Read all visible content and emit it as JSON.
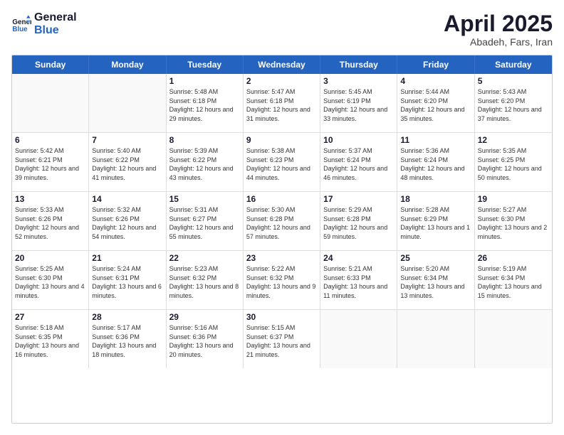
{
  "logo": {
    "line1": "General",
    "line2": "Blue"
  },
  "title": "April 2025",
  "subtitle": "Abadeh, Fars, Iran",
  "days": [
    "Sunday",
    "Monday",
    "Tuesday",
    "Wednesday",
    "Thursday",
    "Friday",
    "Saturday"
  ],
  "weeks": [
    [
      {
        "day": "",
        "empty": true
      },
      {
        "day": "",
        "empty": true
      },
      {
        "day": "1",
        "sunrise": "5:48 AM",
        "sunset": "6:18 PM",
        "daylight": "12 hours and 29 minutes."
      },
      {
        "day": "2",
        "sunrise": "5:47 AM",
        "sunset": "6:18 PM",
        "daylight": "12 hours and 31 minutes."
      },
      {
        "day": "3",
        "sunrise": "5:45 AM",
        "sunset": "6:19 PM",
        "daylight": "12 hours and 33 minutes."
      },
      {
        "day": "4",
        "sunrise": "5:44 AM",
        "sunset": "6:20 PM",
        "daylight": "12 hours and 35 minutes."
      },
      {
        "day": "5",
        "sunrise": "5:43 AM",
        "sunset": "6:20 PM",
        "daylight": "12 hours and 37 minutes."
      }
    ],
    [
      {
        "day": "6",
        "sunrise": "5:42 AM",
        "sunset": "6:21 PM",
        "daylight": "12 hours and 39 minutes."
      },
      {
        "day": "7",
        "sunrise": "5:40 AM",
        "sunset": "6:22 PM",
        "daylight": "12 hours and 41 minutes."
      },
      {
        "day": "8",
        "sunrise": "5:39 AM",
        "sunset": "6:22 PM",
        "daylight": "12 hours and 43 minutes."
      },
      {
        "day": "9",
        "sunrise": "5:38 AM",
        "sunset": "6:23 PM",
        "daylight": "12 hours and 44 minutes."
      },
      {
        "day": "10",
        "sunrise": "5:37 AM",
        "sunset": "6:24 PM",
        "daylight": "12 hours and 46 minutes."
      },
      {
        "day": "11",
        "sunrise": "5:36 AM",
        "sunset": "6:24 PM",
        "daylight": "12 hours and 48 minutes."
      },
      {
        "day": "12",
        "sunrise": "5:35 AM",
        "sunset": "6:25 PM",
        "daylight": "12 hours and 50 minutes."
      }
    ],
    [
      {
        "day": "13",
        "sunrise": "5:33 AM",
        "sunset": "6:26 PM",
        "daylight": "12 hours and 52 minutes."
      },
      {
        "day": "14",
        "sunrise": "5:32 AM",
        "sunset": "6:26 PM",
        "daylight": "12 hours and 54 minutes."
      },
      {
        "day": "15",
        "sunrise": "5:31 AM",
        "sunset": "6:27 PM",
        "daylight": "12 hours and 55 minutes."
      },
      {
        "day": "16",
        "sunrise": "5:30 AM",
        "sunset": "6:28 PM",
        "daylight": "12 hours and 57 minutes."
      },
      {
        "day": "17",
        "sunrise": "5:29 AM",
        "sunset": "6:28 PM",
        "daylight": "12 hours and 59 minutes."
      },
      {
        "day": "18",
        "sunrise": "5:28 AM",
        "sunset": "6:29 PM",
        "daylight": "13 hours and 1 minute."
      },
      {
        "day": "19",
        "sunrise": "5:27 AM",
        "sunset": "6:30 PM",
        "daylight": "13 hours and 2 minutes."
      }
    ],
    [
      {
        "day": "20",
        "sunrise": "5:25 AM",
        "sunset": "6:30 PM",
        "daylight": "13 hours and 4 minutes."
      },
      {
        "day": "21",
        "sunrise": "5:24 AM",
        "sunset": "6:31 PM",
        "daylight": "13 hours and 6 minutes."
      },
      {
        "day": "22",
        "sunrise": "5:23 AM",
        "sunset": "6:32 PM",
        "daylight": "13 hours and 8 minutes."
      },
      {
        "day": "23",
        "sunrise": "5:22 AM",
        "sunset": "6:32 PM",
        "daylight": "13 hours and 9 minutes."
      },
      {
        "day": "24",
        "sunrise": "5:21 AM",
        "sunset": "6:33 PM",
        "daylight": "13 hours and 11 minutes."
      },
      {
        "day": "25",
        "sunrise": "5:20 AM",
        "sunset": "6:34 PM",
        "daylight": "13 hours and 13 minutes."
      },
      {
        "day": "26",
        "sunrise": "5:19 AM",
        "sunset": "6:34 PM",
        "daylight": "13 hours and 15 minutes."
      }
    ],
    [
      {
        "day": "27",
        "sunrise": "5:18 AM",
        "sunset": "6:35 PM",
        "daylight": "13 hours and 16 minutes."
      },
      {
        "day": "28",
        "sunrise": "5:17 AM",
        "sunset": "6:36 PM",
        "daylight": "13 hours and 18 minutes."
      },
      {
        "day": "29",
        "sunrise": "5:16 AM",
        "sunset": "6:36 PM",
        "daylight": "13 hours and 20 minutes."
      },
      {
        "day": "30",
        "sunrise": "5:15 AM",
        "sunset": "6:37 PM",
        "daylight": "13 hours and 21 minutes."
      },
      {
        "day": "",
        "empty": true
      },
      {
        "day": "",
        "empty": true
      },
      {
        "day": "",
        "empty": true
      }
    ]
  ]
}
